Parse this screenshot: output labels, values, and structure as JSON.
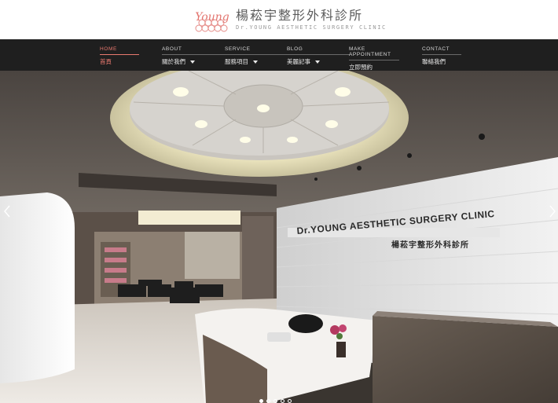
{
  "brand": {
    "logo_mark_text": "Young",
    "name_cn": "楊菘宇整形外科診所",
    "name_en": "Dr.YOUNG AESTHETIC SURGERY CLINIC"
  },
  "nav": {
    "items": [
      {
        "en": "HOME",
        "cn": "首頁",
        "active": true,
        "has_dropdown": false
      },
      {
        "en": "ABOUT",
        "cn": "關於我們",
        "active": false,
        "has_dropdown": true
      },
      {
        "en": "SERVICE",
        "cn": "服務項目",
        "active": false,
        "has_dropdown": true
      },
      {
        "en": "BLOG",
        "cn": "美麗記事",
        "active": false,
        "has_dropdown": true
      },
      {
        "en": "MAKE APPOINTMENT",
        "cn": "立即預約",
        "active": false,
        "has_dropdown": false
      },
      {
        "en": "CONTACT",
        "cn": "聯絡我們",
        "active": false,
        "has_dropdown": false
      }
    ]
  },
  "hero": {
    "wall_sign_en": "Dr.YOUNG AESTHETIC SURGERY CLINIC",
    "wall_sign_cn": "楊菘宇整形外科診所",
    "slides_total": 5,
    "active_slide": 1,
    "prev_icon": "chevron-left-icon",
    "next_icon": "chevron-right-icon"
  },
  "colors": {
    "accent": "#e9796f",
    "nav_bg": "#1f1f1f"
  }
}
